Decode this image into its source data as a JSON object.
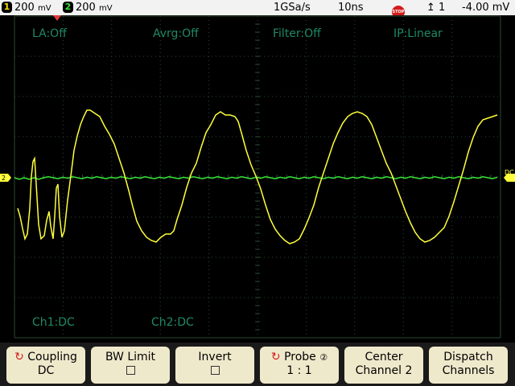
{
  "topbar": {
    "ch1_badge": "1",
    "ch1_scale": "200",
    "ch1_unit": "mV",
    "ch2_badge": "2",
    "ch2_scale": "200",
    "ch2_unit": "mV",
    "sample_rate": "1GSa/s",
    "timebase": "10ns",
    "run_state": "STOP",
    "trigger_channel": "1",
    "trigger_level": "-4.00 mV"
  },
  "overlay": {
    "la": "LA:Off",
    "avrg": "Avrg:Off",
    "filter": "Filter:Off",
    "ip": "IP:Linear",
    "ch1_coupling": "Ch1:DC",
    "ch2_coupling": "Ch2:DC"
  },
  "markers": {
    "ch_left": "2",
    "ch_right": "DC"
  },
  "softkeys": [
    {
      "line1": "Coupling",
      "line2": "DC",
      "icon": "rotary-knob-icon"
    },
    {
      "line1": "BW Limit",
      "line2": "",
      "icon": "checkbox-icon"
    },
    {
      "line1": "Invert",
      "line2": "",
      "icon": "checkbox-icon"
    },
    {
      "line1": "Probe",
      "probe_badge": "②",
      "line2": "1 : 1",
      "icon": "rotary-knob-icon"
    },
    {
      "line1": "Center",
      "line2": "Channel 2"
    },
    {
      "line1": "Dispatch",
      "line2": "Channels"
    }
  ],
  "colors": {
    "ch1_trace": "#ffff3a",
    "ch2_trace": "#37e637",
    "grid": "#2a4a30",
    "overlay_text": "#1f8a63",
    "softkey_bg": "#efe9cc"
  }
}
